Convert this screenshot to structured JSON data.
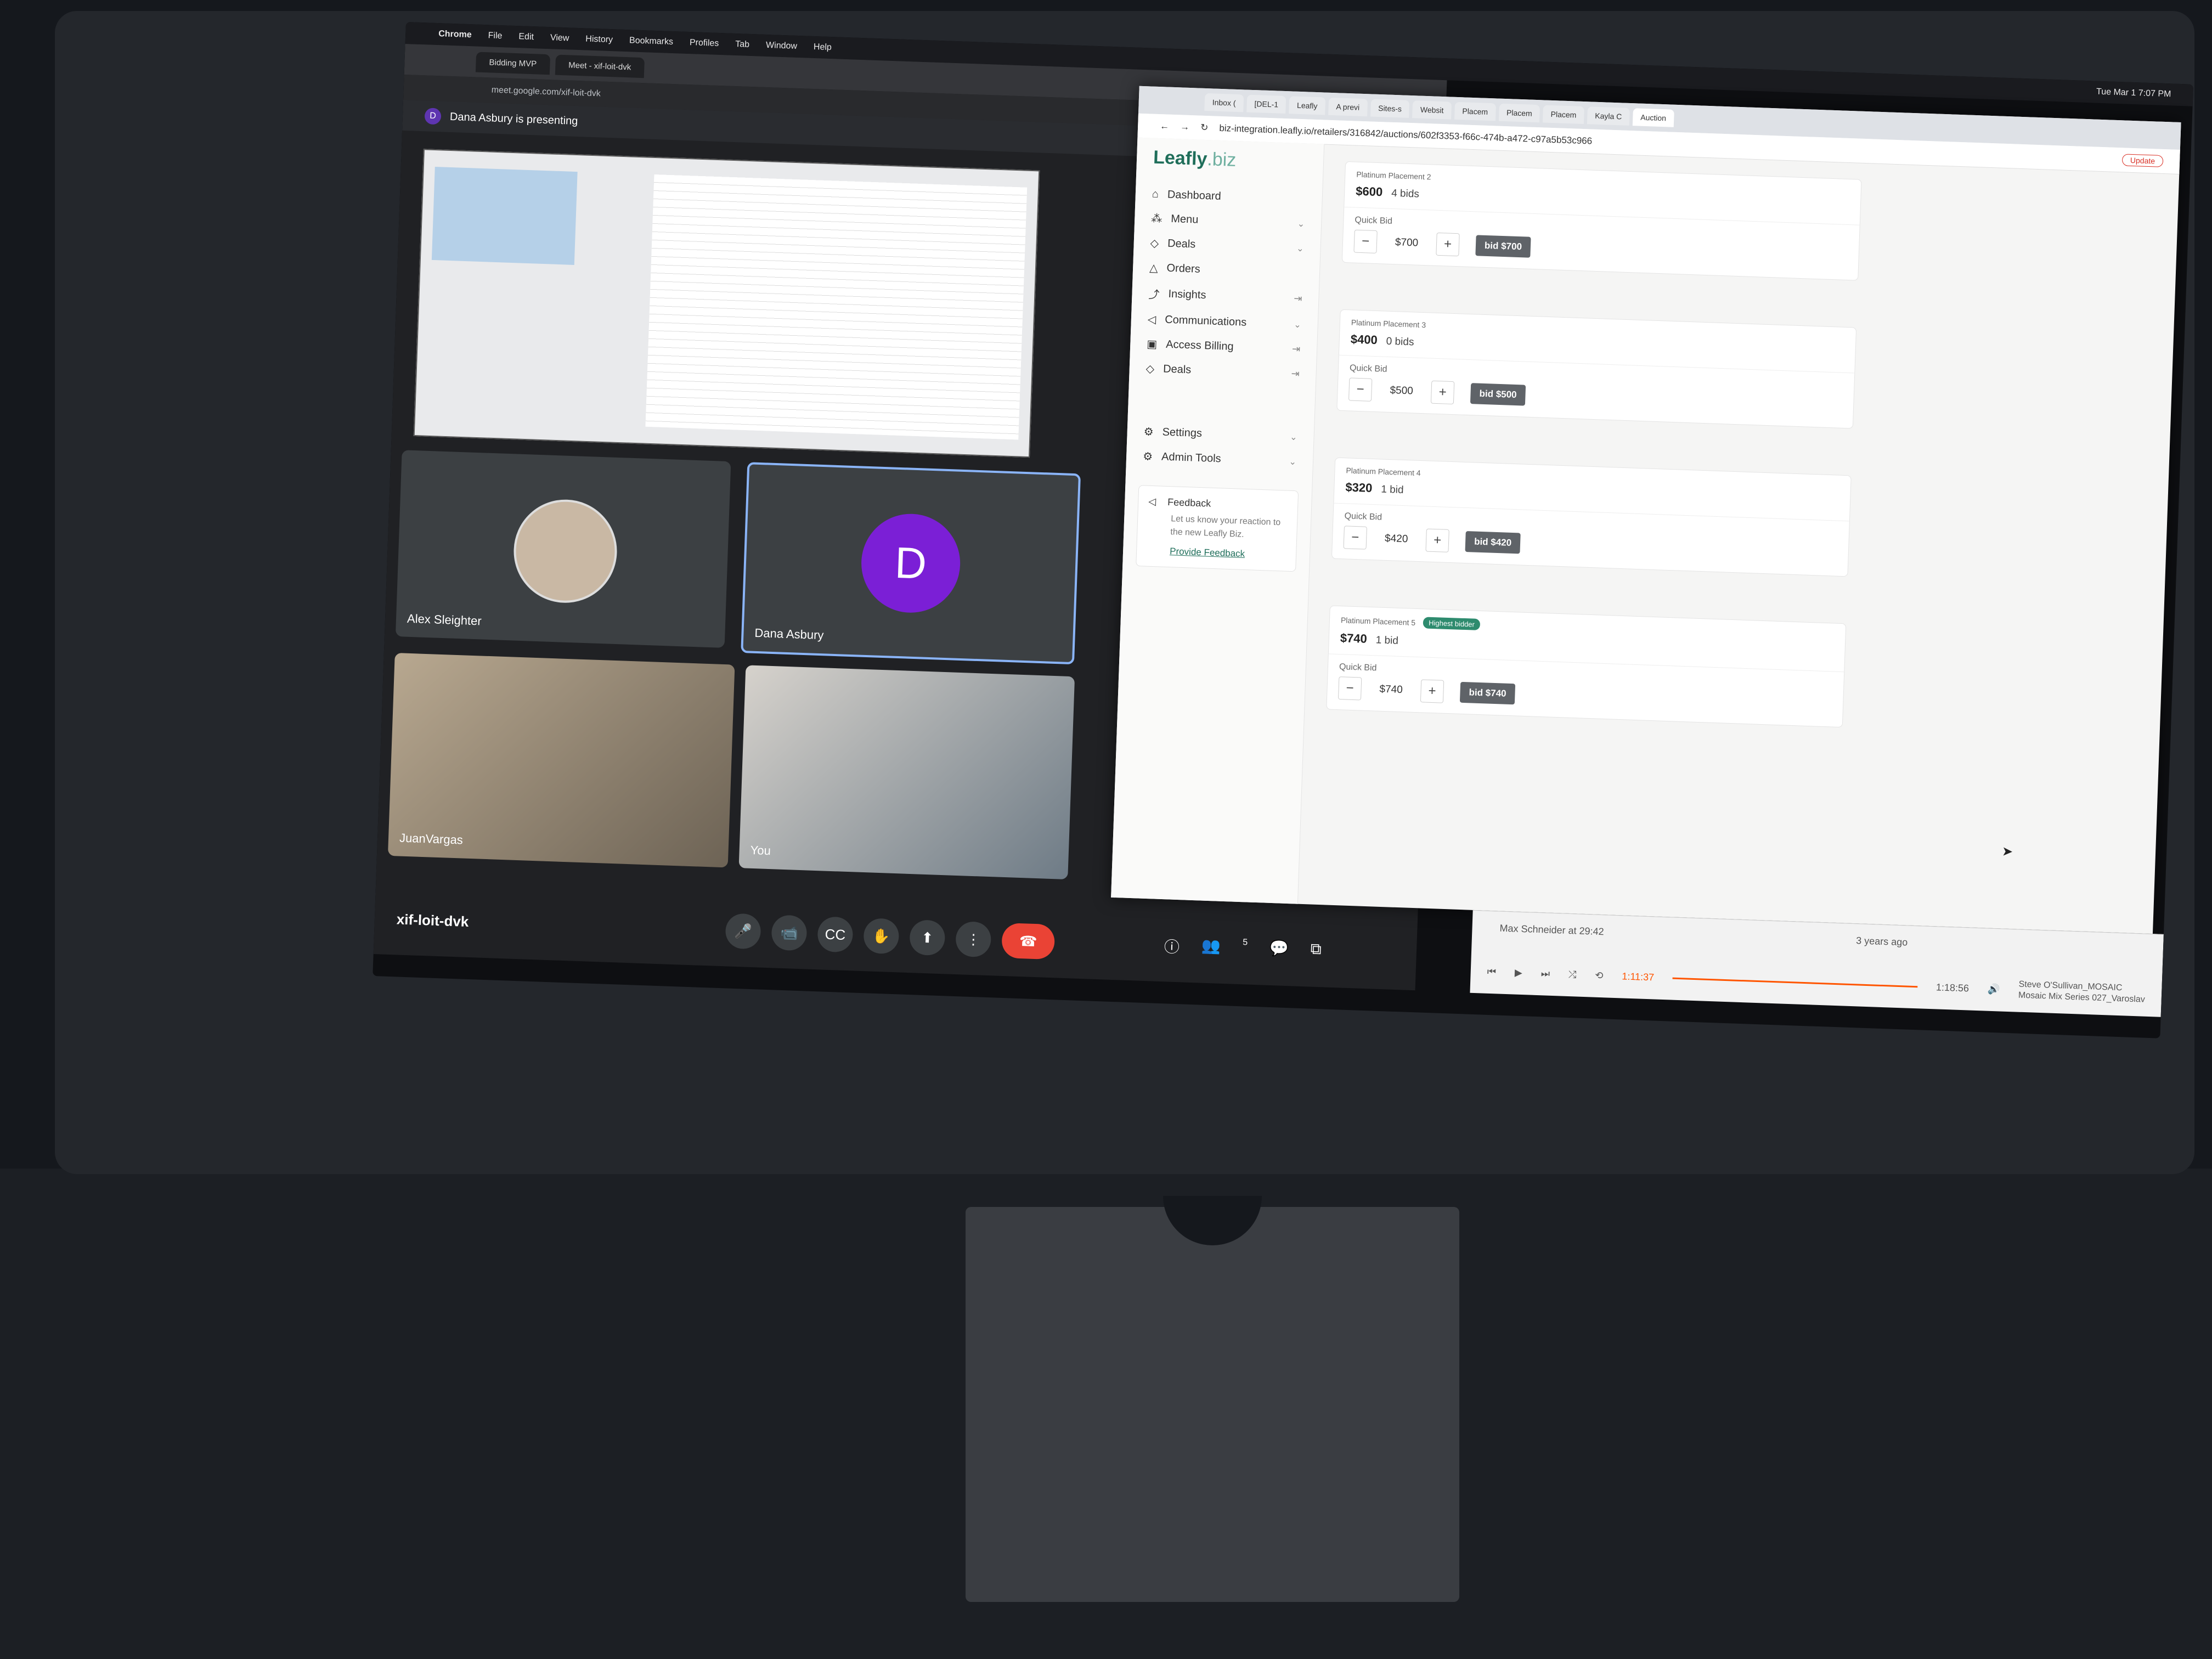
{
  "menubar": {
    "app": "Chrome",
    "items": [
      "File",
      "Edit",
      "View",
      "History",
      "Bookmarks",
      "Profiles",
      "Tab",
      "Window",
      "Help"
    ],
    "clock": "Tue Mar 1  7:07 PM"
  },
  "meet": {
    "tab_title": "Meet - xif-loit-dvk",
    "other_tab": "Bidding MVP",
    "url": "meet.google.com/xif-loit-dvk",
    "presenting_initial": "D",
    "presenting_text": "Dana Asbury is presenting",
    "participants": [
      {
        "name": "Alex Sleighter"
      },
      {
        "name": "Dana Asbury",
        "initial": "D"
      },
      {
        "name": "JuanVargas"
      },
      {
        "name": "You"
      }
    ],
    "meeting_code": "xif-loit-dvk",
    "participant_count": "5",
    "controls": {
      "mic": "🎤",
      "camera": "📹",
      "captions": "CC",
      "hand": "✋",
      "present": "⬆",
      "more": "⋮",
      "end": "☎"
    },
    "right_controls": {
      "info": "ⓘ",
      "people": "👥",
      "chat": "💬",
      "activities": "⧉"
    }
  },
  "leafly": {
    "tabs": [
      "Inbox (",
      "[DEL-1",
      "Leafly",
      "A previ",
      "Sites-s",
      "Websit",
      "Placem",
      "Placem",
      "Placem",
      "Kayla C",
      "Auction"
    ],
    "url": "biz-integration.leafly.io/retailers/316842/auctions/602f3353-f66c-474b-a472-c97a5b53c966",
    "update_label": "Update",
    "logo_main": "Leafly",
    "logo_suffix": ".biz",
    "nav": [
      {
        "label": "Dashboard",
        "icon": "⌂"
      },
      {
        "label": "Menu",
        "icon": "⁂"
      },
      {
        "label": "Deals",
        "icon": "◇"
      },
      {
        "label": "Orders",
        "icon": "△"
      },
      {
        "label": "Insights",
        "icon": "⤴"
      },
      {
        "label": "Communications",
        "icon": "◁"
      },
      {
        "label": "Access Billing",
        "icon": "▣"
      },
      {
        "label": "Deals",
        "icon": "◇"
      }
    ],
    "nav_bottom": [
      {
        "label": "Settings",
        "icon": "⚙"
      },
      {
        "label": "Admin Tools",
        "icon": "⚙"
      }
    ],
    "feedback": {
      "title": "Feedback",
      "body": "Let us know your reaction to the new Leafly Biz.",
      "link": "Provide Feedback"
    },
    "placements": [
      {
        "title": "Platinum Placement 2",
        "amount": "$600",
        "bids": "4 bids",
        "quick_bid_label": "Quick Bid",
        "value": "$700",
        "bid_label": "bid $700",
        "badge": ""
      },
      {
        "title": "Platinum Placement 3",
        "amount": "$400",
        "bids": "0 bids",
        "quick_bid_label": "Quick Bid",
        "value": "$500",
        "bid_label": "bid $500",
        "badge": ""
      },
      {
        "title": "Platinum Placement 4",
        "amount": "$320",
        "bids": "1 bid",
        "quick_bid_label": "Quick Bid",
        "value": "$420",
        "bid_label": "bid $420",
        "badge": ""
      },
      {
        "title": "Platinum Placement 5",
        "amount": "$740",
        "bids": "1 bid",
        "quick_bid_label": "Quick Bid",
        "value": "$740",
        "bid_label": "bid $740",
        "badge": "Highest bidder"
      }
    ]
  },
  "player": {
    "comment": "Max Schneider at 29:42",
    "ago": "3 years ago",
    "elapsed": "1:11:37",
    "duration": "1:18:56",
    "artist": "Steve O'Sullivan_MOSAIC",
    "track": "Mosaic Mix Series 027_Varoslav"
  },
  "colors": {
    "accent": "#1f6e5a",
    "badge": "#2e8b6e",
    "end_call": "#ea4335",
    "avatar": "#7b1fd6"
  }
}
